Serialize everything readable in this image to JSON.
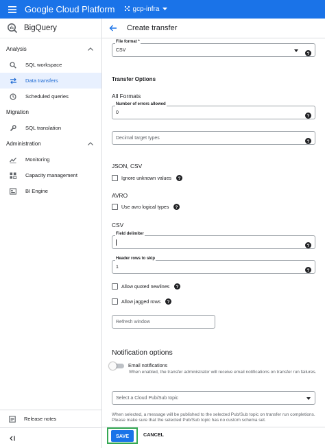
{
  "header": {
    "brand": "Google Cloud Platform",
    "project": "gcp-infra",
    "accent_color": "#1a73e8"
  },
  "sidebar": {
    "product": "BigQuery",
    "sections": [
      {
        "title": "Analysis",
        "items": [
          {
            "label": "SQL workspace",
            "icon": "search-icon"
          },
          {
            "label": "Data transfers",
            "icon": "transfer-icon",
            "active": true
          },
          {
            "label": "Scheduled queries",
            "icon": "clock-icon"
          }
        ]
      },
      {
        "title": "Migration",
        "items": [
          {
            "label": "SQL translation",
            "icon": "wrench-icon"
          }
        ]
      },
      {
        "title": "Administration",
        "items": [
          {
            "label": "Monitoring",
            "icon": "monitoring-icon"
          },
          {
            "label": "Capacity management",
            "icon": "capacity-icon"
          },
          {
            "label": "BI Engine",
            "icon": "bi-engine-icon"
          }
        ]
      }
    ],
    "release_notes": "Release notes",
    "collapse": "<|"
  },
  "main": {
    "title": "Create transfer",
    "file_format": {
      "label": "File format *",
      "value": "CSV"
    },
    "transfer_options": "Transfer Options",
    "all_formats": "All Formats",
    "errors_allowed": {
      "label": "Number of errors allowed",
      "value": "0"
    },
    "decimal_target": {
      "placeholder": "Decimal target types"
    },
    "json_csv": "JSON, CSV",
    "ignore_unknown": "Ignore unknown values",
    "avro": "AVRO",
    "avro_logical": "Use avro logical types",
    "csv": "CSV",
    "field_delimiter": {
      "label": "Field delimiter",
      "value": ""
    },
    "header_rows": {
      "label": "Header rows to skip",
      "value": "1"
    },
    "allow_quoted": "Allow quoted newlines",
    "allow_jagged": "Allow jagged rows",
    "refresh_window": {
      "placeholder": "Refresh window"
    },
    "notification_options": "Notification options",
    "email_notifications": "Email notifications",
    "email_hint": "When enabled, the transfer administrator will receive email notifications on transfer run failures.",
    "pubsub": {
      "placeholder": "Select a Cloud Pub/Sub topic"
    },
    "pubsub_hint": "When selected, a message will be published to the selected Pub/Sub topic on transfer run completions. Please make sure that the selected Pub/Sub topic has no custom schema set.",
    "save": "SAVE",
    "cancel": "CANCEL"
  }
}
